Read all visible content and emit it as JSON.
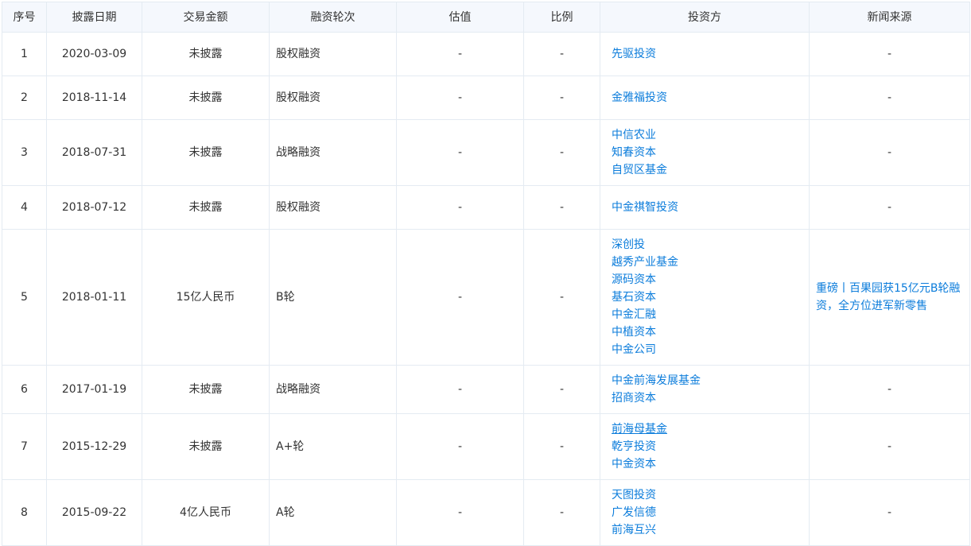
{
  "headers": [
    "序号",
    "披露日期",
    "交易金额",
    "融资轮次",
    "估值",
    "比例",
    "投资方",
    "新闻来源"
  ],
  "rows": [
    {
      "seq": "1",
      "date": "2020-03-09",
      "amount": "未披露",
      "round": "股权融资",
      "valuation": "-",
      "ratio": "-",
      "investors": [
        "先驱投资"
      ],
      "news": "-"
    },
    {
      "seq": "2",
      "date": "2018-11-14",
      "amount": "未披露",
      "round": "股权融资",
      "valuation": "-",
      "ratio": "-",
      "investors": [
        "金雅福投资"
      ],
      "news": "-"
    },
    {
      "seq": "3",
      "date": "2018-07-31",
      "amount": "未披露",
      "round": "战略融资",
      "valuation": "-",
      "ratio": "-",
      "investors": [
        "中信农业",
        "知春资本",
        "自贸区基金"
      ],
      "news": "-"
    },
    {
      "seq": "4",
      "date": "2018-07-12",
      "amount": "未披露",
      "round": "股权融资",
      "valuation": "-",
      "ratio": "-",
      "investors": [
        "中金祺智投资"
      ],
      "news": "-"
    },
    {
      "seq": "5",
      "date": "2018-01-11",
      "amount": "15亿人民币",
      "round": "B轮",
      "valuation": "-",
      "ratio": "-",
      "investors": [
        "深创投",
        "越秀产业基金",
        "源码资本",
        "基石资本",
        "中金汇融",
        "中植资本",
        "中金公司"
      ],
      "news": "重磅丨百果园获15亿元B轮融资，全方位进军新零售"
    },
    {
      "seq": "6",
      "date": "2017-01-19",
      "amount": "未披露",
      "round": "战略融资",
      "valuation": "-",
      "ratio": "-",
      "investors": [
        "中金前海发展基金",
        "招商资本"
      ],
      "news": "-"
    },
    {
      "seq": "7",
      "date": "2015-12-29",
      "amount": "未披露",
      "round": "A+轮",
      "valuation": "-",
      "ratio": "-",
      "investors": [
        "前海母基金",
        "乾亨投资",
        "中金资本"
      ],
      "news": "-"
    },
    {
      "seq": "8",
      "date": "2015-09-22",
      "amount": "4亿人民币",
      "round": "A轮",
      "valuation": "-",
      "ratio": "-",
      "investors": [
        "天图投资",
        "广发信德",
        "前海互兴"
      ],
      "news": "-"
    }
  ],
  "colors": {
    "link": "#0b7cdb",
    "header_bg": "#f5f8fd",
    "border": "#e4ebf2",
    "text": "#333333"
  }
}
